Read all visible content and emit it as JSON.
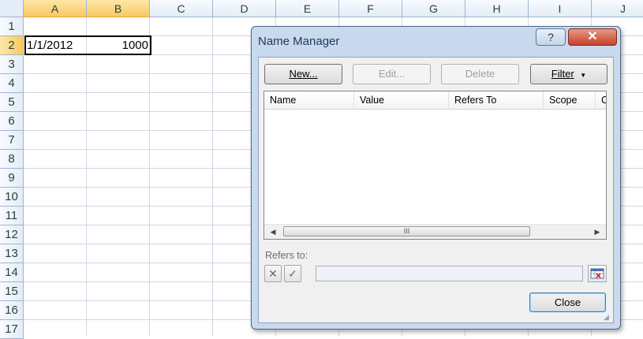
{
  "sheet": {
    "columns": [
      "A",
      "B",
      "C",
      "D",
      "E",
      "F",
      "G",
      "H",
      "I",
      "J"
    ],
    "rows": [
      "1",
      "2",
      "3",
      "4",
      "5",
      "6",
      "7",
      "8",
      "9",
      "10",
      "11",
      "12",
      "13",
      "14",
      "15",
      "16",
      "17"
    ],
    "cells": {
      "A2": "1/1/2012",
      "B2": "1000"
    },
    "selected_columns": [
      "A",
      "B"
    ],
    "selected_row": "2"
  },
  "dialog": {
    "title": "Name Manager",
    "help_label": "?",
    "close_x_label": "✕",
    "buttons": {
      "new_label": "New...",
      "edit_label": "Edit...",
      "delete_label": "Delete",
      "filter_label": "Filter",
      "filter_caret": "▼"
    },
    "list": {
      "headers": [
        "Name",
        "Value",
        "Refers To",
        "Scope",
        "C"
      ],
      "scroll_left": "◀",
      "scroll_right": "▶",
      "thumb_grip": "III"
    },
    "refers_to_label": "Refers to:",
    "cancel_icon": "✕",
    "confirm_icon": "✓",
    "refers_to_value": "",
    "close_label": "Close",
    "colors": {
      "frame": "#c9d9ee",
      "close_red": "#c5412b",
      "selection_header": "#f9c861"
    }
  }
}
